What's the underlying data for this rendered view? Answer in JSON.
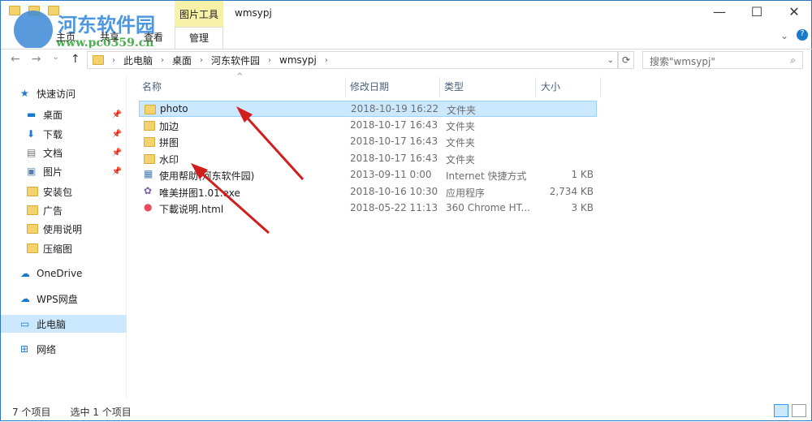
{
  "window": {
    "title": "wmsypj",
    "context_group": "图片工具",
    "context_tab": "管理"
  },
  "ribbon_tabs": [
    "主页",
    "共享",
    "查看"
  ],
  "watermark": {
    "name": "河东软件园",
    "url": "www.pc0359.cn"
  },
  "address": {
    "segments": [
      "此电脑",
      "桌面",
      "河东软件园",
      "wmsypj"
    ]
  },
  "search": {
    "placeholder": "搜索\"wmsypj\""
  },
  "sidebar": [
    {
      "label": "快速访问",
      "icon": "star-icon",
      "top": true
    },
    {
      "label": "桌面",
      "icon": "desktop-icon",
      "pinned": true
    },
    {
      "label": "下载",
      "icon": "download-icon",
      "pinned": true
    },
    {
      "label": "文档",
      "icon": "document-icon",
      "pinned": true
    },
    {
      "label": "图片",
      "icon": "picture-icon",
      "pinned": true
    },
    {
      "label": "安装包",
      "icon": "folder-icon"
    },
    {
      "label": "广告",
      "icon": "folder-icon"
    },
    {
      "label": "使用说明",
      "icon": "folder-icon"
    },
    {
      "label": "压缩图",
      "icon": "folder-icon"
    },
    {
      "label": "OneDrive",
      "icon": "cloud-icon",
      "top": true
    },
    {
      "label": "WPS网盘",
      "icon": "cloud-icon",
      "top": true
    },
    {
      "label": "此电脑",
      "icon": "computer-icon",
      "top": true,
      "selected": true
    },
    {
      "label": "网络",
      "icon": "network-icon",
      "top": true
    }
  ],
  "columns": [
    "名称",
    "修改日期",
    "类型",
    "大小"
  ],
  "files": [
    {
      "name": "photo",
      "date": "2018-10-19 16:22",
      "type": "文件夹",
      "size": "",
      "icon": "folder-icon",
      "selected": true
    },
    {
      "name": "加边",
      "date": "2018-10-17 16:43",
      "type": "文件夹",
      "size": "",
      "icon": "folder-icon"
    },
    {
      "name": "拼图",
      "date": "2018-10-17 16:43",
      "type": "文件夹",
      "size": "",
      "icon": "folder-icon"
    },
    {
      "name": "水印",
      "date": "2018-10-17 16:43",
      "type": "文件夹",
      "size": "",
      "icon": "folder-icon"
    },
    {
      "name": "使用帮助(河东软件园)",
      "date": "2013-09-11 0:00",
      "type": "Internet 快捷方式",
      "size": "1 KB",
      "icon": "shortcut-icon"
    },
    {
      "name": "唯美拼图1.01.exe",
      "date": "2018-10-16 10:30",
      "type": "应用程序",
      "size": "2,734 KB",
      "icon": "app-icon"
    },
    {
      "name": "下載说明.html",
      "date": "2018-05-22 11:13",
      "type": "360 Chrome HT...",
      "size": "3 KB",
      "icon": "html-icon"
    }
  ],
  "status": {
    "count": "7 个项目",
    "selected": "选中 1 个项目"
  }
}
